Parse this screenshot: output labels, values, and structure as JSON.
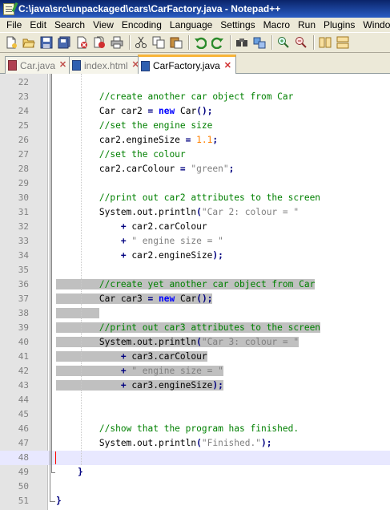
{
  "window": {
    "title": "C:\\java\\src\\unpackaged\\cars\\CarFactory.java - Notepad++"
  },
  "menu": [
    "File",
    "Edit",
    "Search",
    "View",
    "Encoding",
    "Language",
    "Settings",
    "Macro",
    "Run",
    "Plugins",
    "Window",
    "?"
  ],
  "toolbar": {
    "buttons": [
      "new-file",
      "open-file",
      "save",
      "save-all",
      "close",
      "close-all",
      "print",
      "cut",
      "copy",
      "paste",
      "undo",
      "redo",
      "find",
      "replace",
      "zoom-in",
      "zoom-out",
      "sync-vertical",
      "sync-horizontal"
    ]
  },
  "tabs": [
    {
      "label": "Car.java",
      "active": false
    },
    {
      "label": "index.html",
      "active": false
    },
    {
      "label": "CarFactory.java",
      "active": true
    }
  ],
  "colors": {
    "comment": "#008000",
    "keyword": "#0000ff",
    "string": "#808080",
    "number": "#ff8000",
    "selection": "#c0c0c0",
    "caret_line": "#e8e8ff",
    "active_tab_accent": "#f8b53a"
  },
  "editor": {
    "lines": [
      {
        "num": "22",
        "text": ""
      },
      {
        "num": "23",
        "text": "        //create another car object from Car"
      },
      {
        "num": "24",
        "text": "        Car car2 = new Car();"
      },
      {
        "num": "25",
        "text": "        //set the engine size"
      },
      {
        "num": "26",
        "text": "        car2.engineSize = 1.1;"
      },
      {
        "num": "27",
        "text": "        //set the colour"
      },
      {
        "num": "28",
        "text": "        car2.carColour = \"green\";"
      },
      {
        "num": "29",
        "text": ""
      },
      {
        "num": "30",
        "text": "        //print out car2 attributes to the screen"
      },
      {
        "num": "31",
        "text": "        System.out.println(\"Car 2: colour = \""
      },
      {
        "num": "32",
        "text": "            + car2.carColour"
      },
      {
        "num": "33",
        "text": "            + \" engine size = \""
      },
      {
        "num": "34",
        "text": "            + car2.engineSize);"
      },
      {
        "num": "35",
        "text": ""
      },
      {
        "num": "36",
        "text": "        //create yet another car object from Car"
      },
      {
        "num": "37",
        "text": "        Car car3 = new Car();"
      },
      {
        "num": "38",
        "text": ""
      },
      {
        "num": "39",
        "text": "        //print out car3 attributes to the screen"
      },
      {
        "num": "40",
        "text": "        System.out.println(\"Car 3: colour = \""
      },
      {
        "num": "41",
        "text": "            + car3.carColour"
      },
      {
        "num": "42",
        "text": "            + \" engine size = \""
      },
      {
        "num": "43",
        "text": "            + car3.engineSize);"
      },
      {
        "num": "44",
        "text": ""
      },
      {
        "num": "45",
        "text": ""
      },
      {
        "num": "46",
        "text": "        //show that the program has finished."
      },
      {
        "num": "47",
        "text": "        System.out.println(\"Finished.\");"
      },
      {
        "num": "48",
        "text": ""
      },
      {
        "num": "49",
        "text": "    }"
      },
      {
        "num": "50",
        "text": ""
      },
      {
        "num": "51",
        "text": "}"
      }
    ],
    "selected_lines": [
      "36",
      "37",
      "38",
      "39",
      "40",
      "41",
      "42",
      "43"
    ],
    "caret_line": "48"
  }
}
